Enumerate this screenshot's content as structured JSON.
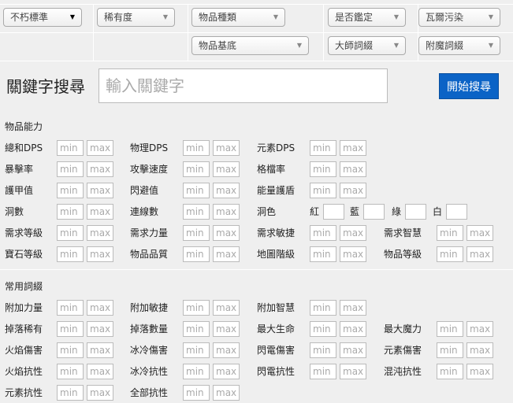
{
  "filters": {
    "row1": [
      {
        "label": "不朽標準",
        "dark": true
      },
      {
        "label": "稀有度"
      },
      {
        "label": "物品種類"
      },
      {
        "label": "是否鑑定"
      },
      {
        "label": "瓦爾污染"
      }
    ],
    "row2": [
      {
        "label": "物品基底"
      },
      {
        "label": "大師詞綴"
      },
      {
        "label": "附魔詞綴"
      }
    ]
  },
  "keyword": {
    "label": "關鍵字搜尋",
    "placeholder": "輸入關鍵字",
    "button": "開始搜尋"
  },
  "placeholders": {
    "min": "min",
    "max": "max"
  },
  "sections": [
    {
      "title": "物品能力",
      "rows": [
        [
          "總和DPS",
          "物理DPS",
          "元素DPS"
        ],
        [
          "暴擊率",
          "攻擊速度",
          "格檔率"
        ],
        [
          "護甲值",
          "閃避值",
          "能量護盾"
        ],
        [
          "洞數",
          "連線數"
        ],
        [
          "需求等級",
          "需求力量",
          "需求敏捷",
          "需求智慧"
        ],
        [
          "寶石等級",
          "物品品質",
          "地圖階級",
          "物品等級"
        ]
      ],
      "socket_color": {
        "label": "洞色",
        "colors": [
          "紅",
          "藍",
          "綠",
          "白"
        ]
      }
    },
    {
      "title": "常用詞綴",
      "rows": [
        [
          "附加力量",
          "附加敏捷",
          "附加智慧"
        ],
        [
          "掉落稀有",
          "掉落數量",
          "最大生命",
          "最大魔力"
        ],
        [
          "火焰傷害",
          "冰冷傷害",
          "閃電傷害",
          "元素傷害"
        ],
        [
          "火焰抗性",
          "冰冷抗性",
          "閃電抗性",
          "混沌抗性"
        ],
        [
          "元素抗性",
          "全部抗性"
        ]
      ]
    }
  ],
  "colors": {
    "accent": "#0b63c6"
  }
}
